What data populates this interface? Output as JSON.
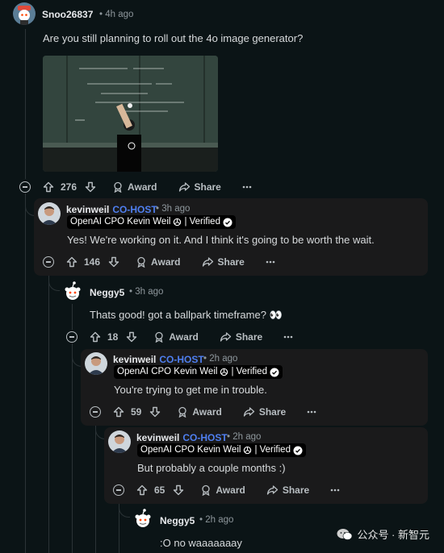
{
  "comments": [
    {
      "username": "Snoo26837",
      "time": "4h ago",
      "body": "Are you still planning to roll out the 4o image generator?",
      "votes": "276",
      "award_label": "Award",
      "share_label": "Share"
    },
    {
      "username": "kevinweil",
      "badge": "CO-HOST",
      "time": "3h ago",
      "flair": "OpenAI CPO Kevin Weil",
      "verified": "| Verified",
      "body": "Yes! We're working on it. And I think it's going to be worth the wait.",
      "votes": "146",
      "award_label": "Award",
      "share_label": "Share"
    },
    {
      "username": "Neggy5",
      "time": "3h ago",
      "body": "Thats good! got a ballpark timeframe? 👀",
      "votes": "18",
      "award_label": "Award",
      "share_label": "Share"
    },
    {
      "username": "kevinweil",
      "badge": "CO-HOST",
      "time": "2h ago",
      "flair": "OpenAI CPO Kevin Weil",
      "verified": "| Verified",
      "body": "You're trying to get me in trouble.",
      "votes": "59",
      "award_label": "Award",
      "share_label": "Share"
    },
    {
      "username": "kevinweil",
      "badge": "CO-HOST",
      "time": "2h ago",
      "flair": "OpenAI CPO Kevin Weil",
      "verified": "| Verified",
      "body": "But probably a couple months :)",
      "votes": "65",
      "award_label": "Award",
      "share_label": "Share"
    },
    {
      "username": "Neggy5",
      "time": "2h ago",
      "body": ":O no waaaaaaay"
    }
  ],
  "image": {
    "blackboard_text": [
      "Transfer between Modalities",
      "Suppose we directly model",
      "P(text, pixels, sound)",
      "With one big autoregressive transformer.",
      "pros: ... pros and cons!",
      "Cons"
    ]
  },
  "watermark": "公众号 · 新智元",
  "colors": {
    "background": "#0b1416",
    "host_panel": "#1a1a1b",
    "cohost_blue": "#4f7ff0",
    "meta_gray": "#8e979c"
  }
}
